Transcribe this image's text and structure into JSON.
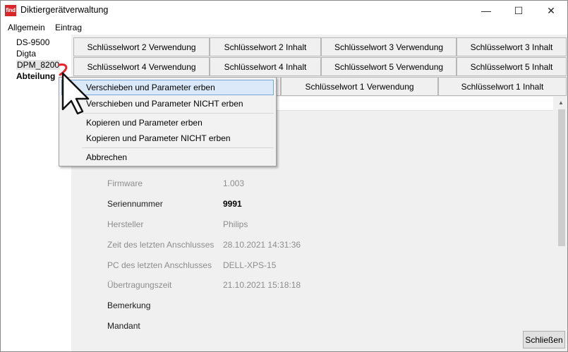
{
  "window": {
    "title": "Diktiergerätverwaltung",
    "icon_text": "find"
  },
  "controls": {
    "minimize": "—",
    "maximize": "☐",
    "close": "✕"
  },
  "menubar": [
    "Allgemein",
    "Eintrag"
  ],
  "tree": [
    {
      "label": "DS-9500"
    },
    {
      "label": "Digta"
    },
    {
      "label": "DPM_8200"
    },
    {
      "label": "Abteilung"
    }
  ],
  "tabs": {
    "row1": [
      "Schlüsselwort 2 Verwendung",
      "Schlüsselwort 2 Inhalt",
      "Schlüsselwort 3 Verwendung",
      "Schlüsselwort 3 Inhalt"
    ],
    "row2": [
      "Schlüsselwort 4 Verwendung",
      "Schlüsselwort 4 Inhalt",
      "Schlüsselwort 5 Verwendung",
      "Schlüsselwort 5 Inhalt"
    ],
    "row3": [
      "Schlüsselwort 1 Verwendung",
      "Schlüsselwort 1 Inhalt"
    ]
  },
  "fields": [
    {
      "label": "Firmware",
      "value": "1.003"
    },
    {
      "label": "Seriennummer",
      "value": "9991"
    },
    {
      "label": "Hersteller",
      "value": "Philips"
    },
    {
      "label": "Zeit des letzten Anschlusses",
      "value": "28.10.2021 14:31:36"
    },
    {
      "label": "PC des letzten Anschlusses",
      "value": "DELL-XPS-15"
    },
    {
      "label": "Übertragungszeit",
      "value": "21.10.2021 15:18:18"
    },
    {
      "label": "Bemerkung",
      "value": ""
    },
    {
      "label": "Mandant",
      "value": ""
    }
  ],
  "context_menu": [
    {
      "label": "Verschieben und Parameter erben"
    },
    {
      "label": "Verschieben und Parameter NICHT erben"
    },
    {
      "label": "Kopieren und Parameter erben"
    },
    {
      "label": "Kopieren und Parameter NICHT erben"
    },
    {
      "label": "Abbrechen"
    }
  ],
  "buttons": {
    "close": "Schließen"
  },
  "colors": {
    "accent_red": "#d9262b",
    "hover_blue": "#dce9f8",
    "hover_border": "#77a6d8",
    "annotation_red": "#e8232a"
  }
}
